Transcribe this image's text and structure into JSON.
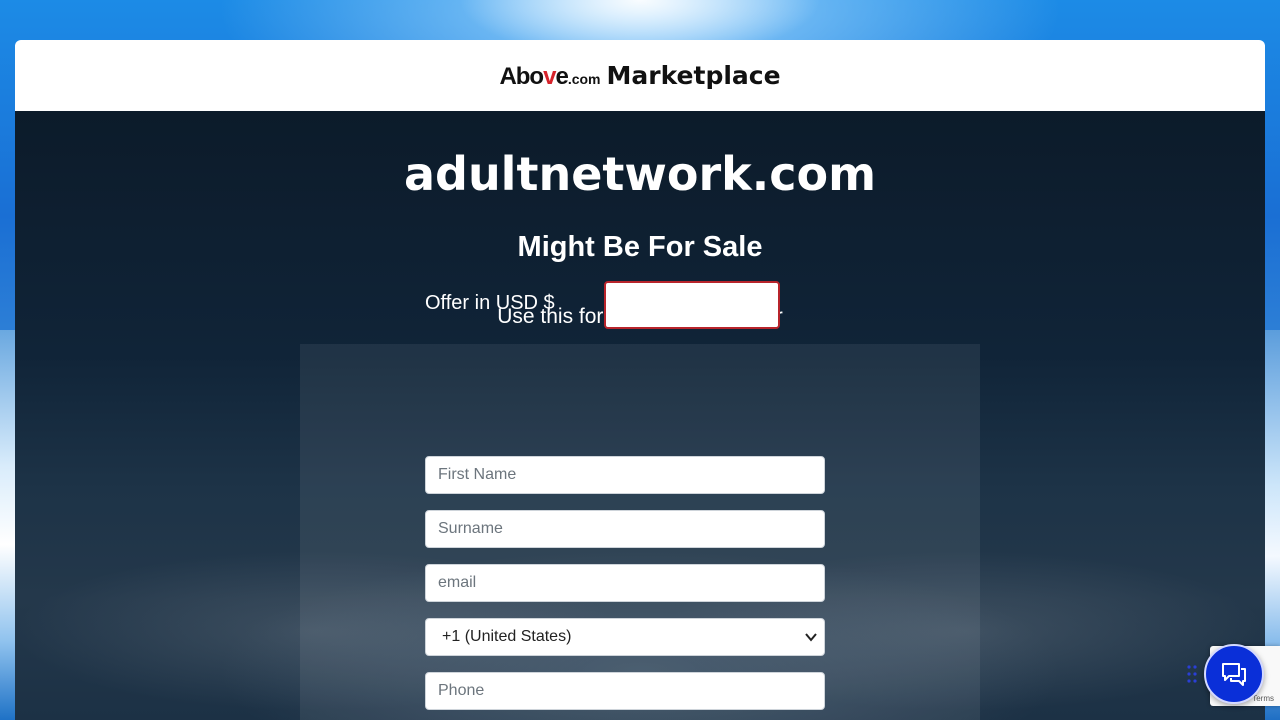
{
  "header": {
    "logo_text": "Above",
    "logo_suffix": ".com",
    "brand": "Marketplace"
  },
  "hero": {
    "domain": "adultnetwork.com",
    "sale_text": "Might Be For Sale",
    "form_intro": "Use this form to Make an Offer"
  },
  "form": {
    "offer_label": "Offer in USD $",
    "offer_value": "",
    "first_name_placeholder": "First Name",
    "surname_placeholder": "Surname",
    "email_placeholder": "email",
    "country_code_selected": "+1 (United States)",
    "phone_placeholder": "Phone"
  },
  "widgets": {
    "recaptcha_terms": "Terms",
    "chat_icon": "chat-bubbles-icon",
    "drag_icon": "drag-handle-icon"
  },
  "colors": {
    "accent_red": "#b8242b",
    "chat_blue": "#0a2fd8"
  }
}
